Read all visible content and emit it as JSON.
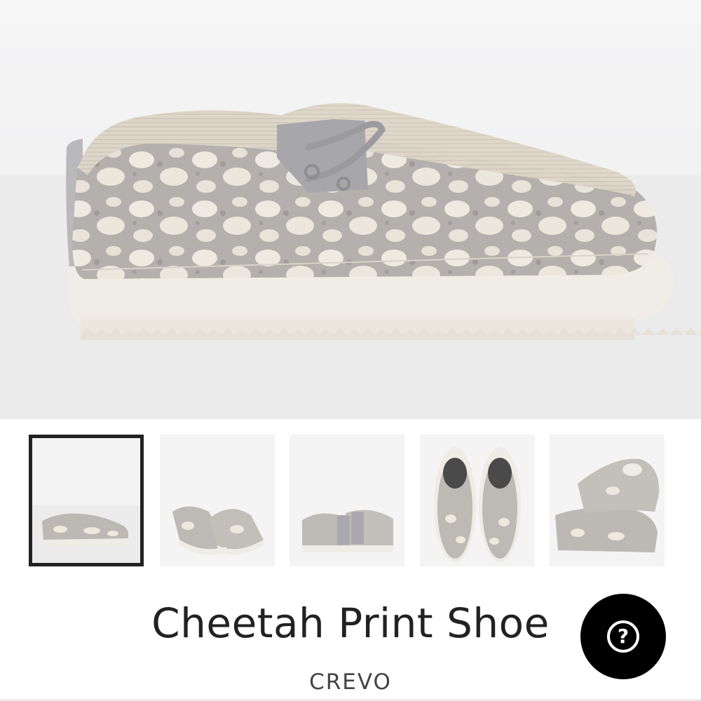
{
  "product": {
    "title": "Cheetah Print Shoe",
    "brand": "CREVO"
  },
  "gallery": {
    "selected_index": 0,
    "thumbnail_count": 5
  },
  "help": {
    "icon": "question-mark-icon",
    "glyph": "?"
  },
  "colors": {
    "background": "#ffffff",
    "text": "#222222",
    "selected_border": "#222222",
    "help_button": "#000000"
  }
}
